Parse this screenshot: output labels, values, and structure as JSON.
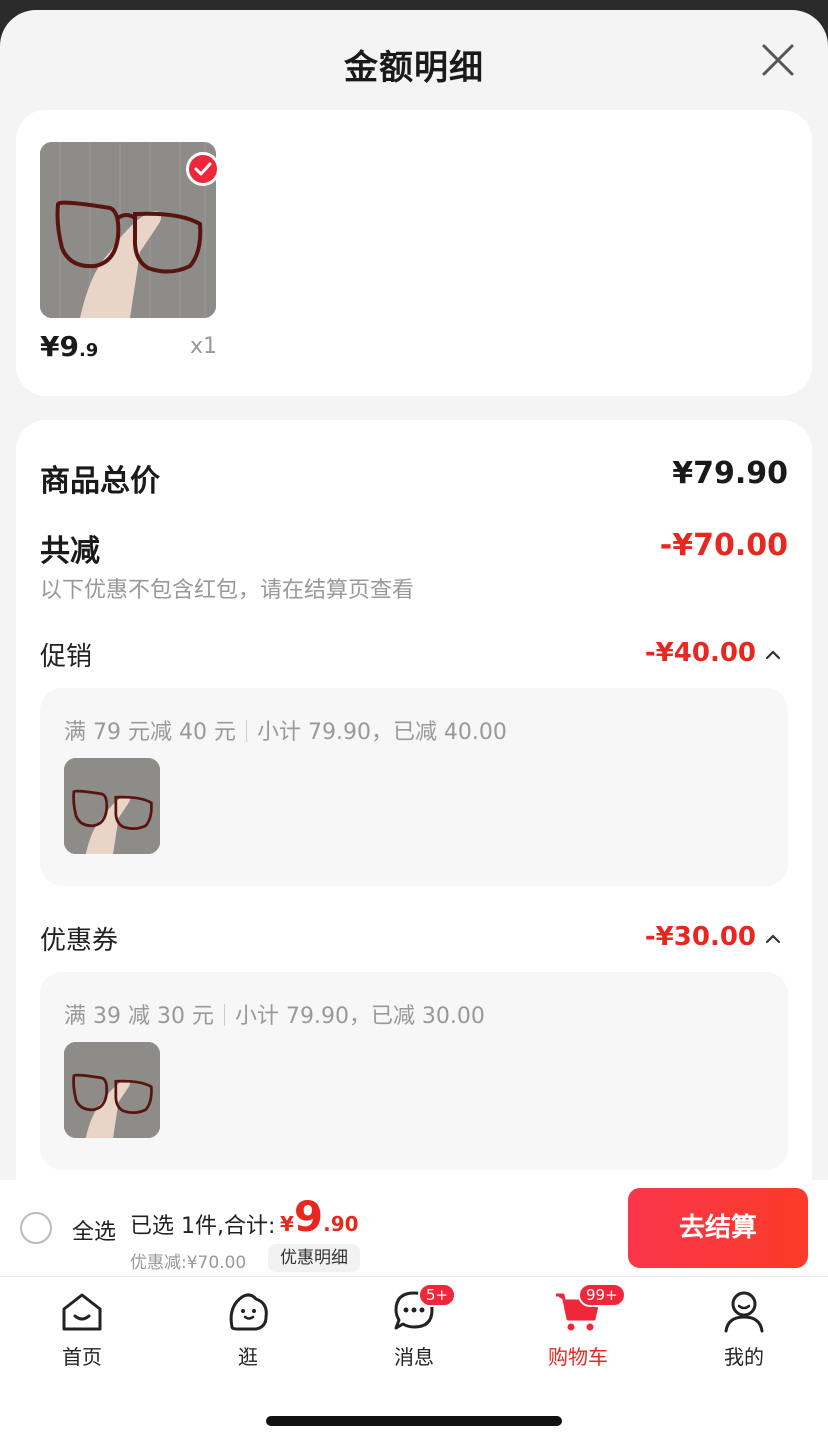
{
  "sheet": {
    "title": "金额明细"
  },
  "product": {
    "price_int": "¥9",
    "price_dec": ".9",
    "qty": "x1"
  },
  "detail": {
    "total_label": "商品总价",
    "total_value": "¥79.90",
    "reduce_label": "共减",
    "reduce_value": "-¥70.00",
    "note": "以下优惠不包含红包，请在结算页查看",
    "promo": {
      "label": "促销",
      "value": "-¥40.00",
      "rule": "满 79 元减 40 元",
      "summary": "小计 79.90，已减 40.00"
    },
    "coupon": {
      "label": "优惠券",
      "value": "-¥30.00",
      "rule": "满 39 减 30 元",
      "summary": "小计 79.90，已减 30.00"
    }
  },
  "bottom_bar": {
    "select_all": "全选",
    "selected_text": "已选 1件,合计:",
    "total_currency": "¥",
    "total_int": "9",
    "total_dec": ".90",
    "discount_text": "优惠减:¥70.00",
    "detail_chip": "优惠明细",
    "checkout_label": "去结算"
  },
  "tabs": [
    {
      "label": "首页",
      "icon": "home-icon"
    },
    {
      "label": "逛",
      "icon": "explore-icon"
    },
    {
      "label": "消息",
      "icon": "message-icon",
      "badge": "5+"
    },
    {
      "label": "购物车",
      "icon": "cart-icon",
      "badge": "99+",
      "active": true
    },
    {
      "label": "我的",
      "icon": "profile-icon"
    }
  ],
  "colors": {
    "accent": "#e8281f",
    "checkout": "#fb3a28"
  }
}
